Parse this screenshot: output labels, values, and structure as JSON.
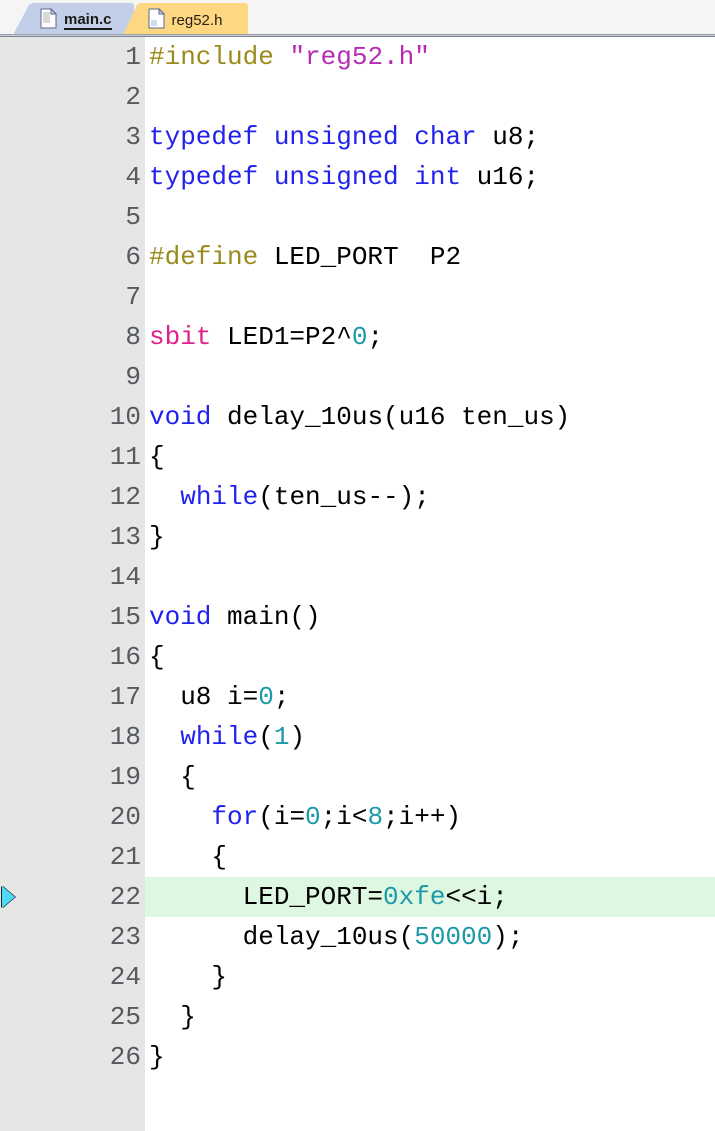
{
  "window": {
    "title": "main.c",
    "kind": "c-source-code-editor"
  },
  "colors": {
    "tab_active_bg": "#fdd782",
    "tab_inactive_bg": "#c3cfe8",
    "gutter_bg": "#e6e6e6",
    "editor_bg": "#ffffff",
    "current_line_highlight": "#ddf7e1",
    "marker_arrow": "#4fd9f5",
    "preprocessor": "#9a8b1c",
    "string": "#b52cb5",
    "keyword": "#2222ee",
    "sbit_keyword": "#e0218a",
    "number": "#1b9aa8",
    "plain_text": "#000000",
    "line_number": "#555a5f"
  },
  "tabs": [
    {
      "label": "main.c",
      "icon": "document-icon",
      "state": "selected-underlined"
    },
    {
      "label": "reg52.h",
      "icon": "document-icon",
      "state": "active-highlighted"
    }
  ],
  "editor": {
    "marker_line": 22,
    "marker_icon": "execution-arrow-icon",
    "highlighted_line": 22,
    "total_lines": 26,
    "lines": [
      {
        "n": "1",
        "tokens": [
          {
            "t": "#include",
            "c": "t-pre"
          },
          {
            "t": " ",
            "c": "t-txt"
          },
          {
            "t": "\"reg52.h\"",
            "c": "t-str"
          }
        ]
      },
      {
        "n": "2",
        "tokens": []
      },
      {
        "n": "3",
        "tokens": [
          {
            "t": "typedef unsigned char",
            "c": "t-kw"
          },
          {
            "t": " u8;",
            "c": "t-txt"
          }
        ]
      },
      {
        "n": "4",
        "tokens": [
          {
            "t": "typedef unsigned int",
            "c": "t-kw"
          },
          {
            "t": " u16;",
            "c": "t-txt"
          }
        ]
      },
      {
        "n": "5",
        "tokens": []
      },
      {
        "n": "6",
        "tokens": [
          {
            "t": "#define",
            "c": "t-pre"
          },
          {
            "t": " LED_PORT  P2",
            "c": "t-txt"
          }
        ]
      },
      {
        "n": "7",
        "tokens": []
      },
      {
        "n": "8",
        "tokens": [
          {
            "t": "sbit",
            "c": "t-sbit"
          },
          {
            "t": " LED1=P2^",
            "c": "t-txt"
          },
          {
            "t": "0",
            "c": "t-num"
          },
          {
            "t": ";",
            "c": "t-txt"
          }
        ]
      },
      {
        "n": "9",
        "tokens": []
      },
      {
        "n": "10",
        "tokens": [
          {
            "t": "void",
            "c": "t-kw"
          },
          {
            "t": " delay_10us(u16 ten_us)",
            "c": "t-txt"
          }
        ]
      },
      {
        "n": "11",
        "tokens": [
          {
            "t": "{",
            "c": "t-txt"
          }
        ]
      },
      {
        "n": "12",
        "tokens": [
          {
            "t": "  ",
            "c": "t-txt"
          },
          {
            "t": "while",
            "c": "t-kw"
          },
          {
            "t": "(ten_us--);",
            "c": "t-txt"
          }
        ]
      },
      {
        "n": "13",
        "tokens": [
          {
            "t": "}",
            "c": "t-txt"
          }
        ]
      },
      {
        "n": "14",
        "tokens": []
      },
      {
        "n": "15",
        "tokens": [
          {
            "t": "void",
            "c": "t-kw"
          },
          {
            "t": " main()",
            "c": "t-txt"
          }
        ]
      },
      {
        "n": "16",
        "tokens": [
          {
            "t": "{",
            "c": "t-txt"
          }
        ]
      },
      {
        "n": "17",
        "tokens": [
          {
            "t": "  u8 i=",
            "c": "t-txt"
          },
          {
            "t": "0",
            "c": "t-num"
          },
          {
            "t": ";",
            "c": "t-txt"
          }
        ]
      },
      {
        "n": "18",
        "tokens": [
          {
            "t": "  ",
            "c": "t-txt"
          },
          {
            "t": "while",
            "c": "t-kw"
          },
          {
            "t": "(",
            "c": "t-txt"
          },
          {
            "t": "1",
            "c": "t-num"
          },
          {
            "t": ")",
            "c": "t-txt"
          }
        ]
      },
      {
        "n": "19",
        "tokens": [
          {
            "t": "  {",
            "c": "t-txt"
          }
        ]
      },
      {
        "n": "20",
        "tokens": [
          {
            "t": "    ",
            "c": "t-txt"
          },
          {
            "t": "for",
            "c": "t-kw"
          },
          {
            "t": "(i=",
            "c": "t-txt"
          },
          {
            "t": "0",
            "c": "t-num"
          },
          {
            "t": ";i<",
            "c": "t-txt"
          },
          {
            "t": "8",
            "c": "t-num"
          },
          {
            "t": ";i++)",
            "c": "t-txt"
          }
        ]
      },
      {
        "n": "21",
        "tokens": [
          {
            "t": "    {",
            "c": "t-txt"
          }
        ]
      },
      {
        "n": "22",
        "tokens": [
          {
            "t": "      LED_PORT=",
            "c": "t-txt"
          },
          {
            "t": "0xfe",
            "c": "t-num"
          },
          {
            "t": "<<i;",
            "c": "t-txt"
          }
        ]
      },
      {
        "n": "23",
        "tokens": [
          {
            "t": "      delay_10us(",
            "c": "t-txt"
          },
          {
            "t": "50000",
            "c": "t-num"
          },
          {
            "t": ");",
            "c": "t-txt"
          }
        ]
      },
      {
        "n": "24",
        "tokens": [
          {
            "t": "    }",
            "c": "t-txt"
          }
        ]
      },
      {
        "n": "25",
        "tokens": [
          {
            "t": "  }",
            "c": "t-txt"
          }
        ]
      },
      {
        "n": "26",
        "tokens": [
          {
            "t": "}",
            "c": "t-txt"
          }
        ]
      }
    ]
  }
}
